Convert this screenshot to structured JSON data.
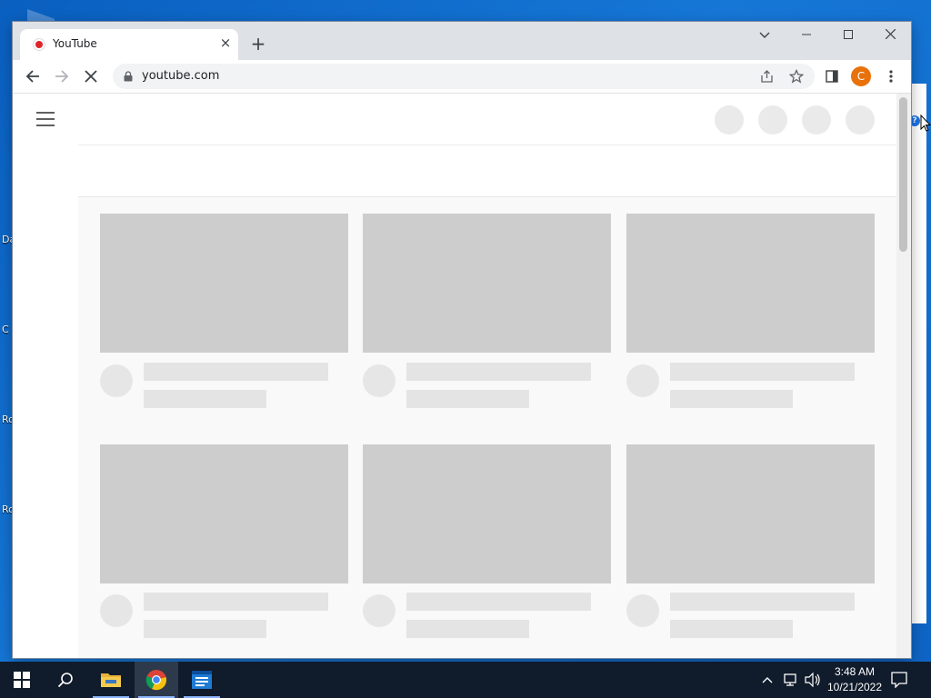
{
  "desktop": {
    "labels": [
      "Da",
      "C",
      "Ro",
      "Ro"
    ]
  },
  "browser": {
    "tab": {
      "title": "YouTube",
      "close": "×"
    },
    "new_tab": "+",
    "window_controls": {
      "tab_search": "⌄",
      "minimize": "—",
      "maximize": "☐",
      "close": "✕"
    },
    "toolbar": {
      "back": "←",
      "forward": "→",
      "reload": "✕",
      "url": "youtube.com",
      "profile_initial": "C",
      "menu": "⋮"
    },
    "page": {
      "state": "loading-skeleton",
      "thumbnails_per_row": 3,
      "rows": 2
    }
  },
  "taskbar": {
    "clock_time": "3:48 AM",
    "clock_date": "10/21/2022",
    "pinned": [
      "start-icon",
      "search-icon",
      "file-explorer-icon",
      "chrome-icon",
      "app-icon"
    ]
  },
  "colors": {
    "desktop_blue": "#0e63c4",
    "profile_orange": "#e8710a",
    "taskbar": "#101b2b",
    "skeleton_thumb": "#cdcdcd",
    "skeleton_line": "#e4e4e4"
  }
}
